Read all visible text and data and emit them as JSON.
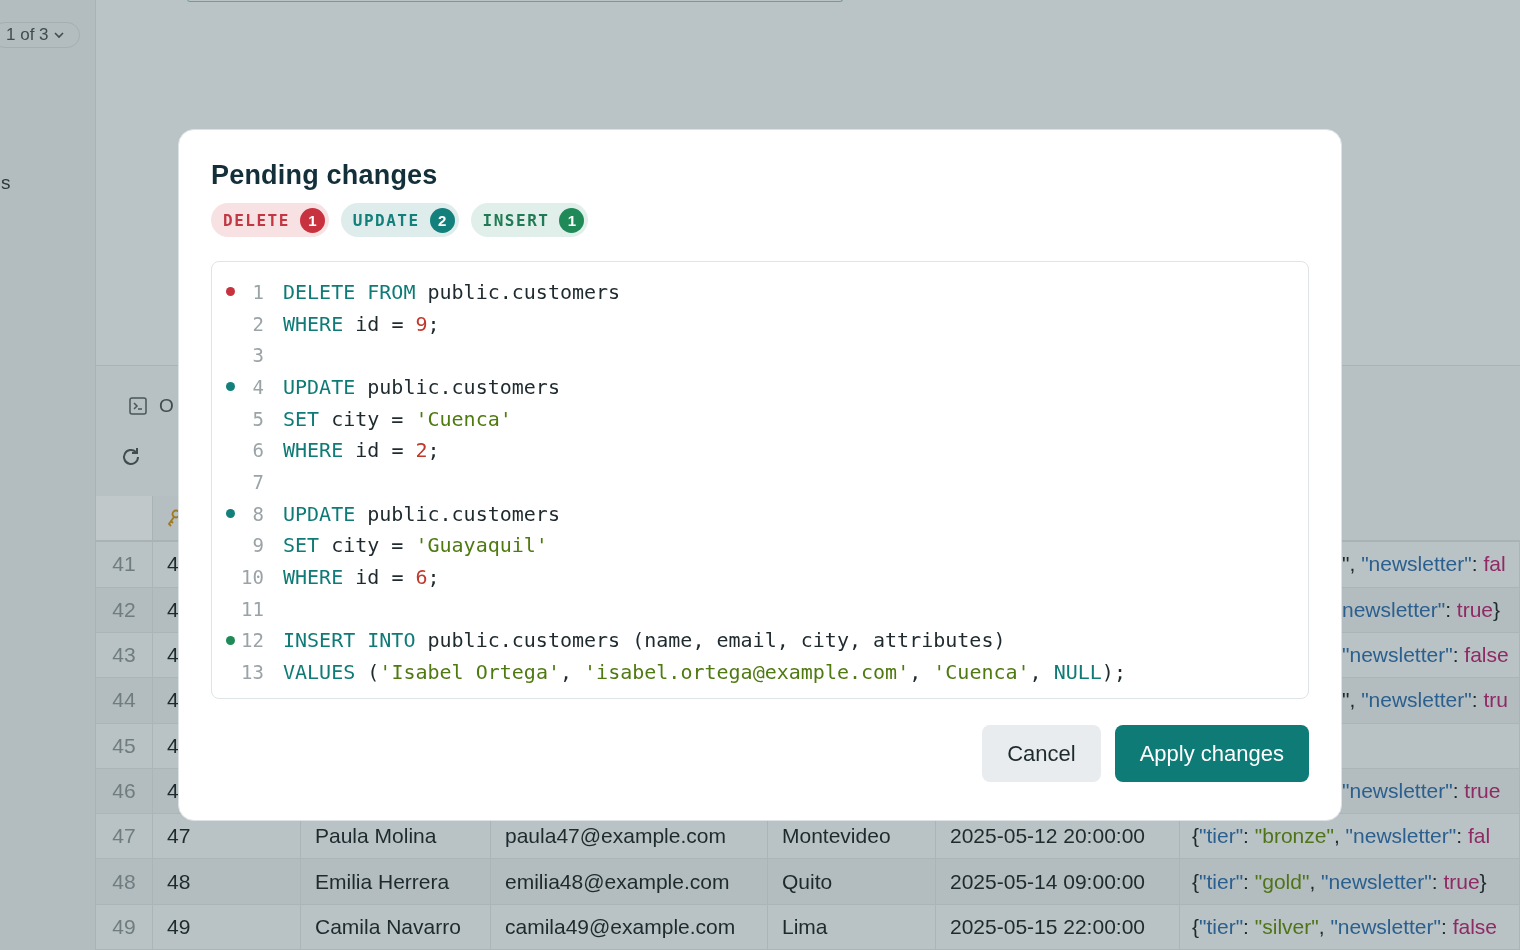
{
  "sidebar": {
    "pager": "1 of 3",
    "label": "s"
  },
  "panel": {
    "tab_label": "O"
  },
  "table": {
    "rows": [
      {
        "number": "41",
        "id": "4",
        "attributes": [
          {
            "kind": "punct",
            "text": "\", "
          },
          {
            "kind": "key",
            "text": "\"newsletter\""
          },
          {
            "kind": "punct",
            "text": ": "
          },
          {
            "kind": "bool",
            "text": "fal"
          }
        ]
      },
      {
        "number": "42",
        "id": "4",
        "attributes": [
          {
            "kind": "key",
            "text": "newsletter\""
          },
          {
            "kind": "punct",
            "text": ": "
          },
          {
            "kind": "bool",
            "text": "true"
          },
          {
            "kind": "punct",
            "text": "}"
          }
        ]
      },
      {
        "number": "43",
        "id": "4",
        "attributes": [
          {
            "kind": "key",
            "text": "\"newsletter\""
          },
          {
            "kind": "punct",
            "text": ": "
          },
          {
            "kind": "bool",
            "text": "false"
          }
        ]
      },
      {
        "number": "44",
        "id": "4",
        "attributes": [
          {
            "kind": "punct",
            "text": "\", "
          },
          {
            "kind": "key",
            "text": "\"newsletter\""
          },
          {
            "kind": "punct",
            "text": ": "
          },
          {
            "kind": "bool",
            "text": "tru"
          }
        ]
      },
      {
        "number": "45",
        "id": "4"
      },
      {
        "number": "46",
        "id": "4",
        "attributes": [
          {
            "kind": "key",
            "text": "\"newsletter\""
          },
          {
            "kind": "punct",
            "text": ": "
          },
          {
            "kind": "bool",
            "text": "true"
          }
        ]
      },
      {
        "number": "47",
        "id": "47",
        "name": "Paula Molina",
        "email": "paula47@example.com",
        "city": "Montevideo",
        "created": "2025-05-12 20:00:00",
        "attributes": [
          {
            "kind": "punct",
            "text": "{"
          },
          {
            "kind": "key",
            "text": "\"tier\""
          },
          {
            "kind": "punct",
            "text": ": "
          },
          {
            "kind": "string",
            "text": "\"bronze\""
          },
          {
            "kind": "punct",
            "text": ", "
          },
          {
            "kind": "key",
            "text": "\"newsletter\""
          },
          {
            "kind": "punct",
            "text": ": "
          },
          {
            "kind": "bool",
            "text": "fal"
          }
        ]
      },
      {
        "number": "48",
        "id": "48",
        "name": "Emilia Herrera",
        "email": "emilia48@example.com",
        "city": "Quito",
        "created": "2025-05-14 09:00:00",
        "attributes": [
          {
            "kind": "punct",
            "text": "{"
          },
          {
            "kind": "key",
            "text": "\"tier\""
          },
          {
            "kind": "punct",
            "text": ": "
          },
          {
            "kind": "string",
            "text": "\"gold\""
          },
          {
            "kind": "punct",
            "text": ", "
          },
          {
            "kind": "key",
            "text": "\"newsletter\""
          },
          {
            "kind": "punct",
            "text": ": "
          },
          {
            "kind": "bool",
            "text": "true"
          },
          {
            "kind": "punct",
            "text": "}"
          }
        ]
      },
      {
        "number": "49",
        "id": "49",
        "name": "Camila Navarro",
        "email": "camila49@example.com",
        "city": "Lima",
        "created": "2025-05-15 22:00:00",
        "attributes": [
          {
            "kind": "punct",
            "text": "{"
          },
          {
            "kind": "key",
            "text": "\"tier\""
          },
          {
            "kind": "punct",
            "text": ": "
          },
          {
            "kind": "string",
            "text": "\"silver\""
          },
          {
            "kind": "punct",
            "text": ", "
          },
          {
            "kind": "key",
            "text": "\"newsletter\""
          },
          {
            "kind": "punct",
            "text": ": "
          },
          {
            "kind": "bool",
            "text": "false"
          }
        ]
      }
    ]
  },
  "dialog": {
    "title": "Pending changes",
    "badges": [
      {
        "kind": "delete",
        "label": "DELETE",
        "count": "1"
      },
      {
        "kind": "update",
        "label": "UPDATE",
        "count": "2"
      },
      {
        "kind": "insert",
        "label": "INSERT",
        "count": "1"
      }
    ],
    "lines": [
      {
        "number": "1",
        "color": "#c8323f",
        "tokens": [
          {
            "kind": "keyword",
            "text": "DELETE FROM"
          },
          {
            "kind": "plain",
            "text": " public.customers"
          }
        ]
      },
      {
        "number": "2",
        "tokens": [
          {
            "kind": "keyword",
            "text": "WHERE"
          },
          {
            "kind": "plain",
            "text": " id = "
          },
          {
            "kind": "number",
            "text": "9"
          },
          {
            "kind": "plain",
            "text": ";"
          }
        ]
      },
      {
        "number": "3"
      },
      {
        "number": "4",
        "color": "#13807c",
        "tokens": [
          {
            "kind": "keyword",
            "text": "UPDATE"
          },
          {
            "kind": "plain",
            "text": " public.customers"
          }
        ]
      },
      {
        "number": "5",
        "tokens": [
          {
            "kind": "keyword",
            "text": "SET"
          },
          {
            "kind": "plain",
            "text": " city = "
          },
          {
            "kind": "string",
            "text": "'Cuenca'"
          }
        ]
      },
      {
        "number": "6",
        "tokens": [
          {
            "kind": "keyword",
            "text": "WHERE"
          },
          {
            "kind": "plain",
            "text": " id = "
          },
          {
            "kind": "number",
            "text": "2"
          },
          {
            "kind": "plain",
            "text": ";"
          }
        ]
      },
      {
        "number": "7"
      },
      {
        "number": "8",
        "color": "#13807c",
        "tokens": [
          {
            "kind": "keyword",
            "text": "UPDATE"
          },
          {
            "kind": "plain",
            "text": " public.customers"
          }
        ]
      },
      {
        "number": "9",
        "tokens": [
          {
            "kind": "keyword",
            "text": "SET"
          },
          {
            "kind": "plain",
            "text": " city = "
          },
          {
            "kind": "string",
            "text": "'Guayaquil'"
          }
        ]
      },
      {
        "number": "10",
        "tokens": [
          {
            "kind": "keyword",
            "text": "WHERE"
          },
          {
            "kind": "plain",
            "text": " id = "
          },
          {
            "kind": "number",
            "text": "6"
          },
          {
            "kind": "plain",
            "text": ";"
          }
        ]
      },
      {
        "number": "11"
      },
      {
        "number": "12",
        "color": "#1f8a58",
        "tokens": [
          {
            "kind": "keyword",
            "text": "INSERT INTO"
          },
          {
            "kind": "plain",
            "text": " public.customers (name, email, city, attributes)"
          }
        ]
      },
      {
        "number": "13",
        "tokens": [
          {
            "kind": "keyword",
            "text": "VALUES"
          },
          {
            "kind": "plain",
            "text": " ("
          },
          {
            "kind": "string",
            "text": "'Isabel Ortega'"
          },
          {
            "kind": "plain",
            "text": ", "
          },
          {
            "kind": "string",
            "text": "'isabel.ortega@example.com'"
          },
          {
            "kind": "plain",
            "text": ", "
          },
          {
            "kind": "string",
            "text": "'Cuenca'"
          },
          {
            "kind": "plain",
            "text": ", "
          },
          {
            "kind": "keyword",
            "text": "NULL"
          },
          {
            "kind": "plain",
            "text": ");"
          }
        ]
      }
    ],
    "buttons": [
      {
        "kind": "secondary",
        "label": "Cancel"
      },
      {
        "kind": "primary",
        "label": "Apply changes"
      }
    ]
  }
}
